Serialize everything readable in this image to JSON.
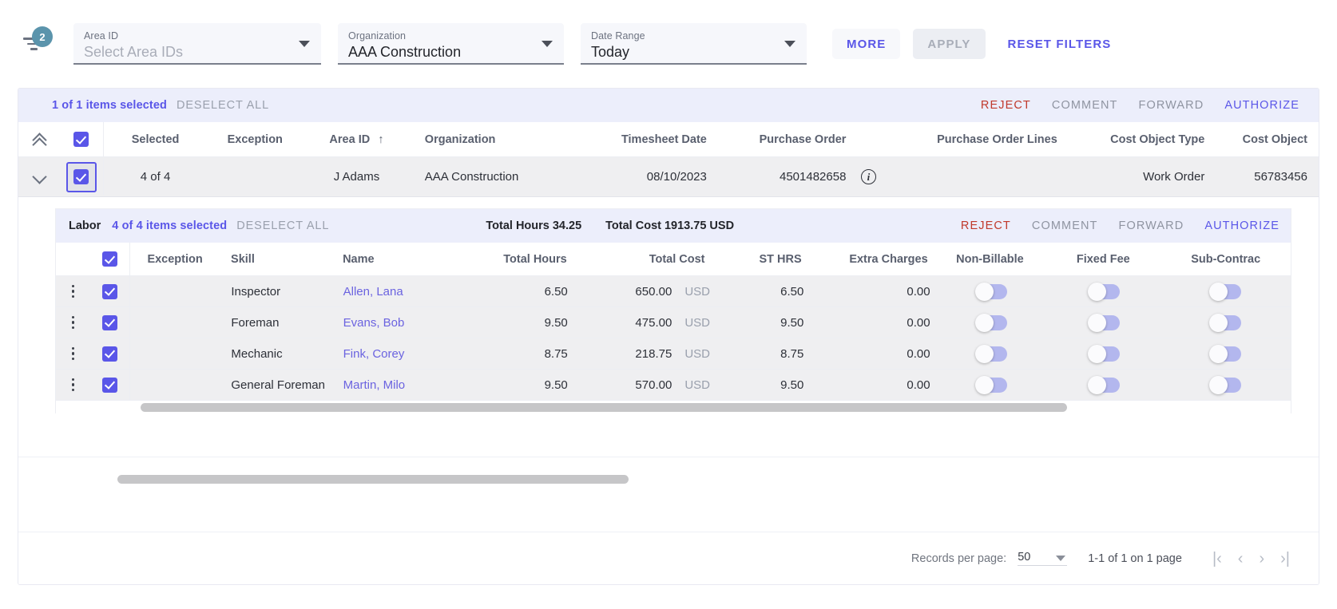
{
  "filters": {
    "badge_count": "2",
    "filter_icon": "filter-icon",
    "area_id": {
      "label": "Area ID",
      "value": "Select Area IDs",
      "is_placeholder": true
    },
    "organization": {
      "label": "Organization",
      "value": "AAA Construction",
      "is_placeholder": false
    },
    "date_range": {
      "label": "Date Range",
      "value": "Today",
      "is_placeholder": false
    },
    "more_label": "MORE",
    "apply_label": "APPLY",
    "reset_label": "RESET FILTERS"
  },
  "outer_selection_bar": {
    "count_text": "1 of 1 items selected",
    "deselect_label": "DESELECT ALL",
    "actions": {
      "reject": "REJECT",
      "comment": "COMMENT",
      "forward": "FORWARD",
      "authorize": "AUTHORIZE"
    }
  },
  "outer_table": {
    "headers": {
      "selected": "Selected",
      "exception": "Exception",
      "area_id": "Area ID",
      "sort_arrow": "↑",
      "organization": "Organization",
      "timesheet_date": "Timesheet Date",
      "purchase_order": "Purchase Order",
      "purchase_order_lines": "Purchase Order Lines",
      "cost_object_type": "Cost Object Type",
      "cost_object": "Cost Object"
    },
    "row": {
      "selected": "4 of 4",
      "exception": "",
      "area_id": "J Adams",
      "organization": "AAA Construction",
      "timesheet_date": "08/10/2023",
      "purchase_order": "4501482658",
      "purchase_order_info_icon": "info-icon",
      "purchase_order_lines": "",
      "cost_object_type": "Work Order",
      "cost_object": "56783456"
    }
  },
  "labor_panel": {
    "title": "Labor",
    "count_text": "4 of 4 items selected",
    "deselect_label": "DESELECT ALL",
    "total_hours": "Total Hours 34.25",
    "total_cost": "Total Cost 1913.75 USD",
    "actions": {
      "reject": "REJECT",
      "comment": "COMMENT",
      "forward": "FORWARD",
      "authorize": "AUTHORIZE"
    },
    "headers": {
      "exception": "Exception",
      "skill": "Skill",
      "name": "Name",
      "total_hours": "Total Hours",
      "total_cost": "Total Cost",
      "st_hrs": "ST HRS",
      "extra_charges": "Extra Charges",
      "non_billable": "Non-Billable",
      "fixed_fee": "Fixed Fee",
      "sub_contract": "Sub-Contrac"
    },
    "rows": [
      {
        "skill": "Inspector",
        "name": "Allen, Lana",
        "total_hours": "6.50",
        "total_cost": "650.00",
        "currency": "USD",
        "st_hrs": "6.50",
        "extra_charges": "0.00",
        "non_billable": false,
        "fixed_fee": false,
        "sub_contract": false
      },
      {
        "skill": "Foreman",
        "name": "Evans, Bob",
        "total_hours": "9.50",
        "total_cost": "475.00",
        "currency": "USD",
        "st_hrs": "9.50",
        "extra_charges": "0.00",
        "non_billable": false,
        "fixed_fee": false,
        "sub_contract": false
      },
      {
        "skill": "Mechanic",
        "name": "Fink, Corey",
        "total_hours": "8.75",
        "total_cost": "218.75",
        "currency": "USD",
        "st_hrs": "8.75",
        "extra_charges": "0.00",
        "non_billable": false,
        "fixed_fee": false,
        "sub_contract": false
      },
      {
        "skill": "General Foreman",
        "name": "Martin, Milo",
        "total_hours": "9.50",
        "total_cost": "570.00",
        "currency": "USD",
        "st_hrs": "9.50",
        "extra_charges": "0.00",
        "non_billable": false,
        "fixed_fee": false,
        "sub_contract": false
      }
    ]
  },
  "footer": {
    "records_per_page_label": "Records per page:",
    "records_per_page_value": "50",
    "page_range": "1-1 of 1 on 1 page",
    "pager": {
      "first": "|‹",
      "prev": "‹",
      "next": "›",
      "last": "›|"
    }
  },
  "colors": {
    "accent": "#5a56e8",
    "reject": "#c0392b",
    "selection_bar_bg": "#eceefb",
    "row_bg": "#efeff1",
    "badge": "#5b94ac"
  }
}
